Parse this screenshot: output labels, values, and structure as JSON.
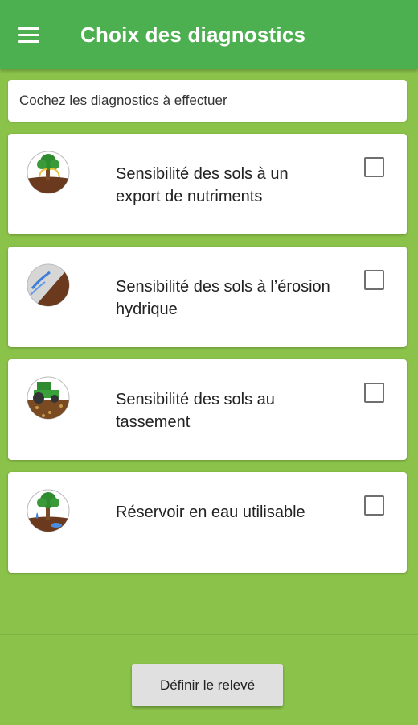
{
  "appbar": {
    "title": "Choix des diagnostics",
    "menu_icon": "hamburger-menu-icon"
  },
  "instruction": "Cochez les diagnostics à effectuer",
  "diagnostics": [
    {
      "label": "Sensibilité des sols à un export de nutriments",
      "icon": "tree-soil-nutrients-icon",
      "checked": false
    },
    {
      "label": "Sensibilité des sols à l’érosion hydrique",
      "icon": "water-erosion-icon",
      "checked": false
    },
    {
      "label": "Sensibilité des sols au tassement",
      "icon": "tractor-compaction-icon",
      "checked": false
    },
    {
      "label": "Réservoir en eau utilisable",
      "icon": "tree-water-reservoir-icon",
      "checked": false
    }
  ],
  "footer": {
    "button_label": "Définir le relevé"
  },
  "colors": {
    "appbar": "#4caf50",
    "background": "#8bc34a",
    "card": "#ffffff",
    "button": "#e0e0e0"
  }
}
